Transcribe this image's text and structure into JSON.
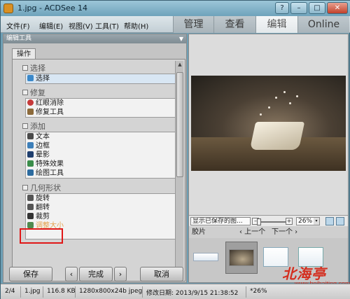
{
  "window": {
    "title": "1.jpg - ACDSee 14",
    "controls": [
      "?",
      "–",
      "□",
      "✕"
    ]
  },
  "menu": {
    "items": [
      "文件(F)",
      "编辑(E)",
      "视图(V)",
      "工具(T)",
      "帮助(H)"
    ]
  },
  "modes": {
    "tabs": [
      "管理",
      "查看",
      "编辑",
      "Online"
    ],
    "active": "编辑"
  },
  "left_panel": {
    "header": "编辑工具",
    "op_tab": "操作",
    "groups": [
      {
        "title": "选择",
        "items": [
          "选择"
        ]
      },
      {
        "title": "修复",
        "items": [
          "红眼消除",
          "修复工具"
        ]
      },
      {
        "title": "添加",
        "items": [
          "文本",
          "边框",
          "晕影",
          "特殊效果",
          "绘图工具"
        ]
      },
      {
        "title": "几何形状",
        "items": [
          "旋转",
          "翻转",
          "裁剪",
          "调整大小"
        ]
      }
    ],
    "buttons": {
      "save": "保存",
      "prev": "‹",
      "done": "完成",
      "next": "›",
      "cancel": "取消"
    }
  },
  "preview": {
    "saved_view_label": "显示已保存的图...",
    "zoom_minus": "–",
    "zoom_plus": "+",
    "zoom_level": "26%",
    "zoom_dropdown": "▾",
    "filmstrip_label": "胶片",
    "prev_label": "‹ 上一个",
    "next_label": "下一个 ›"
  },
  "watermark": {
    "text": "北海亭",
    "url": "www.beihaiting.com"
  },
  "status": {
    "index": "2/4",
    "filename": "1.jpg",
    "filesize": "116.8 KB",
    "dimensions": "1280x800x24b jpeg",
    "modified": "修改日期: 2013/9/15 21:38:52",
    "zoom": "*26%"
  }
}
